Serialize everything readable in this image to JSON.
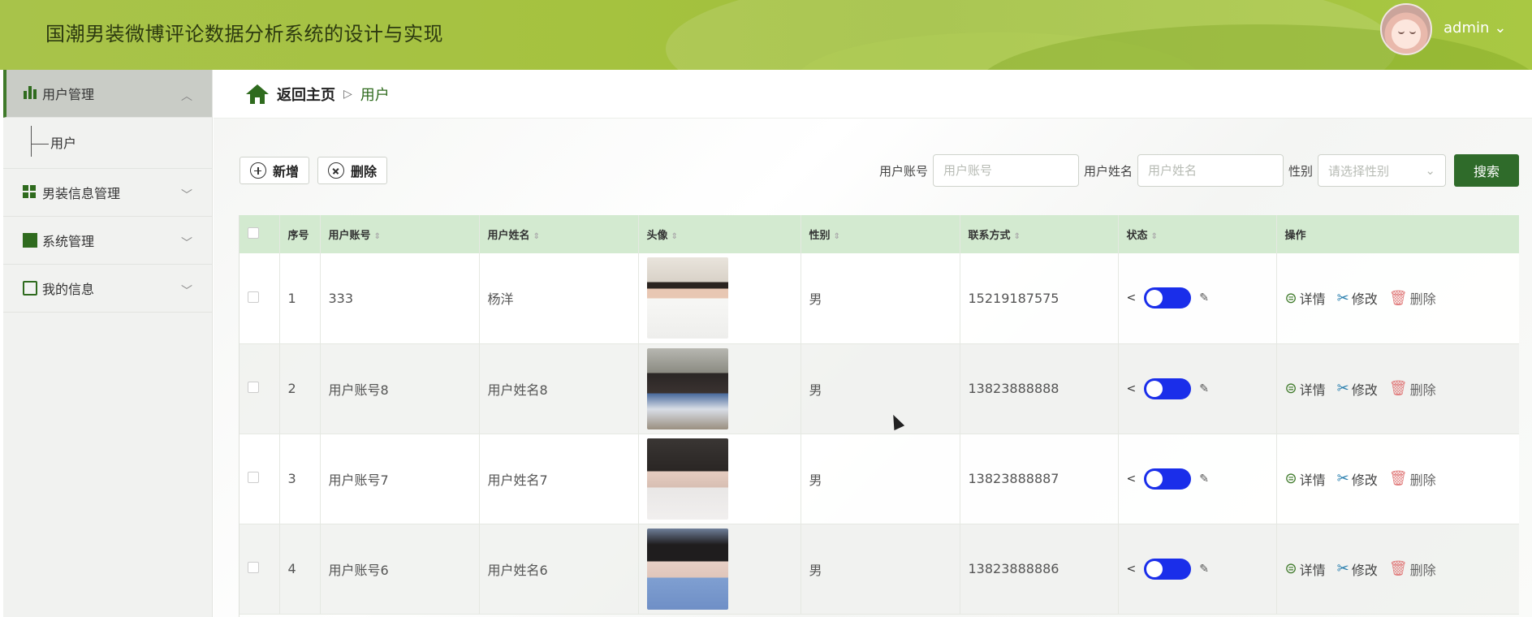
{
  "header": {
    "title": "国潮男装微博评论数据分析系统的设计与实现",
    "user": "admin"
  },
  "sidebar": {
    "groups": [
      {
        "label": "用户管理",
        "items": [
          {
            "label": "用户"
          }
        ]
      },
      {
        "label": "男装信息管理"
      },
      {
        "label": "系统管理"
      },
      {
        "label": "我的信息"
      }
    ]
  },
  "breadcrumb": {
    "home": "返回主页",
    "separator": "▷",
    "current": "用户"
  },
  "toolbar": {
    "add_label": "新增",
    "delete_label": "删除"
  },
  "search": {
    "account_label": "用户账号",
    "account_placeholder": "用户账号",
    "name_label": "用户姓名",
    "name_placeholder": "用户姓名",
    "gender_label": "性别",
    "gender_placeholder": "请选择性别",
    "button_label": "搜索"
  },
  "table": {
    "columns": [
      "序号",
      "用户账号",
      "用户姓名",
      "头像",
      "性别",
      "联系方式",
      "状态",
      "操作"
    ],
    "rows": [
      {
        "index": "1",
        "account": "333",
        "name": "杨洋",
        "gender": "男",
        "phone": "15219187575"
      },
      {
        "index": "2",
        "account": "用户账号8",
        "name": "用户姓名8",
        "gender": "男",
        "phone": "13823888888"
      },
      {
        "index": "3",
        "account": "用户账号7",
        "name": "用户姓名7",
        "gender": "男",
        "phone": "13823888887"
      },
      {
        "index": "4",
        "account": "用户账号6",
        "name": "用户姓名6",
        "gender": "男",
        "phone": "13823888886"
      }
    ],
    "actions": {
      "detail": "详情",
      "edit": "修改",
      "delete": "删除"
    }
  },
  "colors": {
    "header_green": "#a5c23f",
    "accent_dark_green": "#2f6b2a",
    "table_header": "#d3ead0",
    "toggle_blue": "#1a2eea"
  }
}
